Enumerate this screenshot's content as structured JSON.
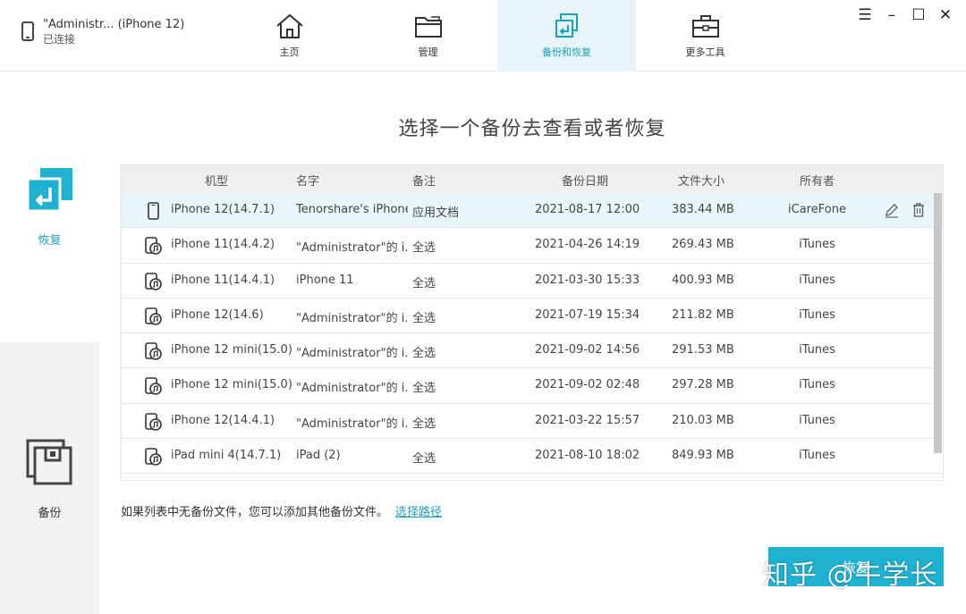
{
  "device": {
    "name": "\"Administr... (iPhone 12)",
    "status": "已连接"
  },
  "nav": [
    {
      "label": "主页",
      "icon": "home-icon"
    },
    {
      "label": "管理",
      "icon": "folder-icon"
    },
    {
      "label": "备份和恢复",
      "icon": "backup-restore-icon",
      "active": true
    },
    {
      "label": "更多工具",
      "icon": "toolbox-icon"
    }
  ],
  "window_controls": {
    "menu": "☰",
    "minimize": "–",
    "maximize": "☐",
    "close": "✕"
  },
  "sidebar": {
    "restore_label": "恢复",
    "backup_label": "备份"
  },
  "main": {
    "title": "选择一个备份去查看或者恢复",
    "columns": {
      "model": "机型",
      "name": "名字",
      "note": "备注",
      "date": "备份日期",
      "size": "文件大小",
      "owner": "所有者"
    },
    "rows": [
      {
        "model": "iPhone 12(14.7.1)",
        "name": "Tenorshare's iPhone",
        "note": "应用文档",
        "date": "2021-08-17 12:00",
        "size": "383.44 MB",
        "owner": "iCareFone",
        "icon": "phone-icon",
        "selected": true
      },
      {
        "model": "iPhone 11(14.4.2)",
        "name": "\"Administrator\"的 i...",
        "note": "全选",
        "date": "2021-04-26 14:19",
        "size": "269.43 MB",
        "owner": "iTunes",
        "icon": "itunes-backup-icon"
      },
      {
        "model": "iPhone 11(14.4.1)",
        "name": "iPhone 11",
        "note": "全选",
        "date": "2021-03-30 15:33",
        "size": "400.93 MB",
        "owner": "iTunes",
        "icon": "itunes-backup-icon"
      },
      {
        "model": "iPhone 12(14.6)",
        "name": "\"Administrator\"的 i...",
        "note": "全选",
        "date": "2021-07-19 15:34",
        "size": "211.82 MB",
        "owner": "iTunes",
        "icon": "itunes-backup-icon"
      },
      {
        "model": "iPhone 12 mini(15.0)",
        "name": "\"Administrator\"的 i...",
        "note": "全选",
        "date": "2021-09-02 14:56",
        "size": "291.53 MB",
        "owner": "iTunes",
        "icon": "itunes-backup-icon"
      },
      {
        "model": "iPhone 12 mini(15.0)",
        "name": "\"Administrator\"的 i...",
        "note": "全选",
        "date": "2021-09-02 02:48",
        "size": "297.28 MB",
        "owner": "iTunes",
        "icon": "itunes-backup-icon"
      },
      {
        "model": "iPhone 12(14.4.1)",
        "name": "\"Administrator\"的 i...",
        "note": "全选",
        "date": "2021-03-22 15:57",
        "size": "210.03 MB",
        "owner": "iTunes",
        "icon": "itunes-backup-icon"
      },
      {
        "model": "iPad mini 4(14.7.1)",
        "name": "iPad (2)",
        "note": "全选",
        "date": "2021-08-10 18:02",
        "size": "849.93 MB",
        "owner": "iTunes",
        "icon": "itunes-backup-icon"
      }
    ],
    "hint_text": "如果列表中无备份文件，您可以添加其他备份文件。",
    "hint_link": "选择路径",
    "restore_button": "恢复",
    "watermark": "知乎 @牛学长"
  },
  "colors": {
    "accent": "#1a9fbd",
    "button": "#1fb1d1",
    "selected_row": "#e9f6f9",
    "sidebar_inactive": "#f2f2f2"
  }
}
